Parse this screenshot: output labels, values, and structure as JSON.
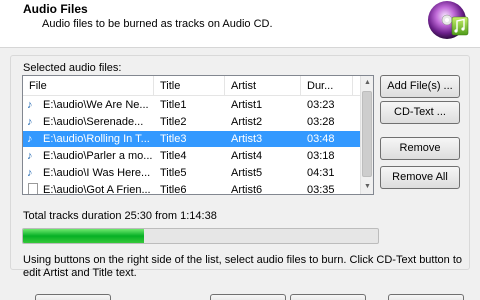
{
  "header": {
    "title": "Audio Files",
    "subtitle": "Audio files to be burned as tracks on Audio CD."
  },
  "list": {
    "label": "Selected audio files:",
    "columns": [
      "File",
      "Title",
      "Artist",
      "Dur..."
    ],
    "rows": [
      {
        "file": "E:\\audio\\We Are Ne...",
        "title": "Title1",
        "artist": "Artist1",
        "duration": "03:23",
        "icon": "audio-note-icon",
        "selected": false
      },
      {
        "file": "E:\\audio\\Serenade...",
        "title": "Title2",
        "artist": "Artist2",
        "duration": "03:28",
        "icon": "audio-note-icon",
        "selected": false
      },
      {
        "file": "E:\\audio\\Rolling In T...",
        "title": "Title3",
        "artist": "Artist3",
        "duration": "03:48",
        "icon": "audio-note-icon",
        "selected": true
      },
      {
        "file": "E:\\audio\\Parler a mo...",
        "title": "Title4",
        "artist": "Artist4",
        "duration": "03:18",
        "icon": "audio-note-icon",
        "selected": false
      },
      {
        "file": "E:\\audio\\I Was Here...",
        "title": "Title5",
        "artist": "Artist5",
        "duration": "04:31",
        "icon": "audio-note-icon",
        "selected": false
      },
      {
        "file": "E:\\audio\\Got A Frien...",
        "title": "Title6",
        "artist": "Artist6",
        "duration": "03:35",
        "icon": "blank-file-icon",
        "selected": false
      }
    ]
  },
  "buttons": {
    "add_files": "Add File(s) ...",
    "cd_text": "CD-Text ...",
    "remove": "Remove",
    "remove_all": "Remove All"
  },
  "total": {
    "label": "Total tracks duration 25:30 from 1:14:38",
    "progress_fraction": 0.341
  },
  "hint": "Using buttons on the right side of the list, select audio files to burn. Click CD-Text button to edit Artist and Title text.",
  "colors": {
    "selection": "#3399ff",
    "progress": "#06b025"
  }
}
